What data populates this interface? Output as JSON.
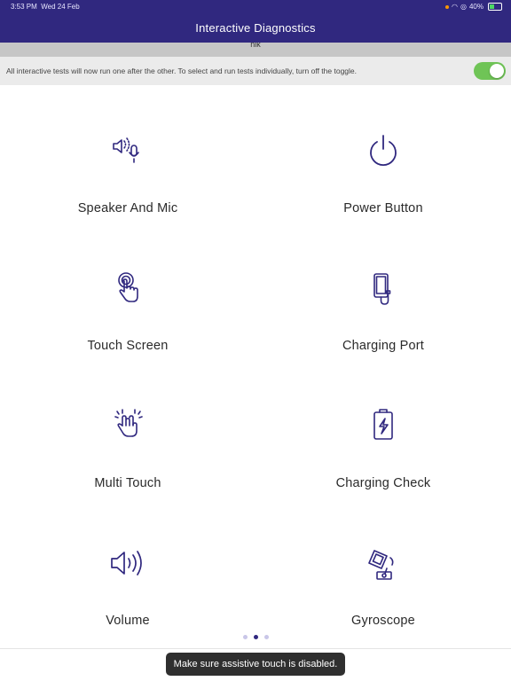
{
  "status": {
    "time": "3:53 PM",
    "date": "Wed 24 Feb",
    "battery": "40%"
  },
  "header": {
    "title": "Interactive Diagnostics"
  },
  "strip": {
    "text": "nik"
  },
  "notice": {
    "text": "All interactive tests will now run one after the other. To select and run tests individually, turn off the toggle.",
    "toggle_on": true
  },
  "tests": [
    {
      "label": "Speaker And Mic",
      "icon": "speaker-mic-icon"
    },
    {
      "label": "Power Button",
      "icon": "power-icon"
    },
    {
      "label": "Touch Screen",
      "icon": "touch-screen-icon"
    },
    {
      "label": "Charging Port",
      "icon": "charging-port-icon"
    },
    {
      "label": "Multi Touch",
      "icon": "multi-touch-icon"
    },
    {
      "label": "Charging Check",
      "icon": "battery-charging-icon"
    },
    {
      "label": "Volume",
      "icon": "volume-icon"
    },
    {
      "label": "Gyroscope",
      "icon": "gyroscope-icon"
    }
  ],
  "pager": {
    "page": 2,
    "total": 3
  },
  "toast": {
    "text": "Make sure assistive touch is disabled."
  },
  "colors": {
    "brand": "#30287f",
    "toggle": "#6fc456",
    "icon": "#30287f"
  }
}
